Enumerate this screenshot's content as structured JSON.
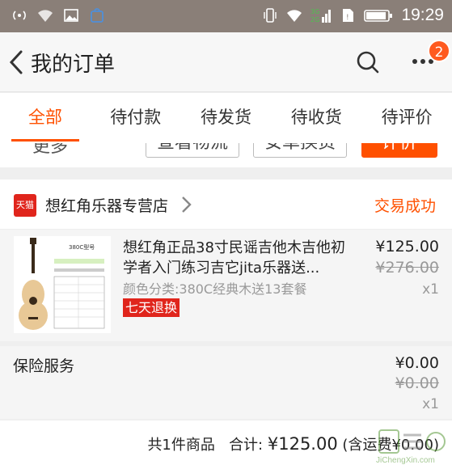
{
  "status_bar": {
    "time": "19:29",
    "network": "3G\n2G"
  },
  "header": {
    "title": "我的订单",
    "badge_count": "2"
  },
  "tabs": [
    {
      "label": "全部",
      "active": true
    },
    {
      "label": "待付款",
      "active": false
    },
    {
      "label": "待发货",
      "active": false
    },
    {
      "label": "待收货",
      "active": false
    },
    {
      "label": "待评价",
      "active": false
    }
  ],
  "peek": {
    "more": "更多",
    "logistics": "查看物流",
    "exchange": "安卓换货",
    "review": "评价"
  },
  "order": {
    "shop_badge": "天猫",
    "shop_name": "想红角乐器专营店",
    "status": "交易成功",
    "item": {
      "title": "想红角正品38寸民谣吉他木吉他初学者入门练习吉它jita乐器送...",
      "sku": "颜色分类:380C经典木送13套餐",
      "tag": "七天退换",
      "price": "¥125.00",
      "original_price": "¥276.00",
      "quantity": "x1",
      "thumb_label": "380C型号"
    },
    "insurance": {
      "label": "保险服务",
      "price": "¥0.00",
      "original_price": "¥0.00",
      "quantity": "x1"
    },
    "summary": {
      "count_text": "共1件商品",
      "total_label": "合计: ",
      "total_value": "¥125.00",
      "shipping": " (含运费¥0.00)"
    }
  },
  "watermark": {
    "site": "JiChengXin.com"
  },
  "colors": {
    "accent": "#ff5000",
    "tmall_red": "#e0251c"
  }
}
